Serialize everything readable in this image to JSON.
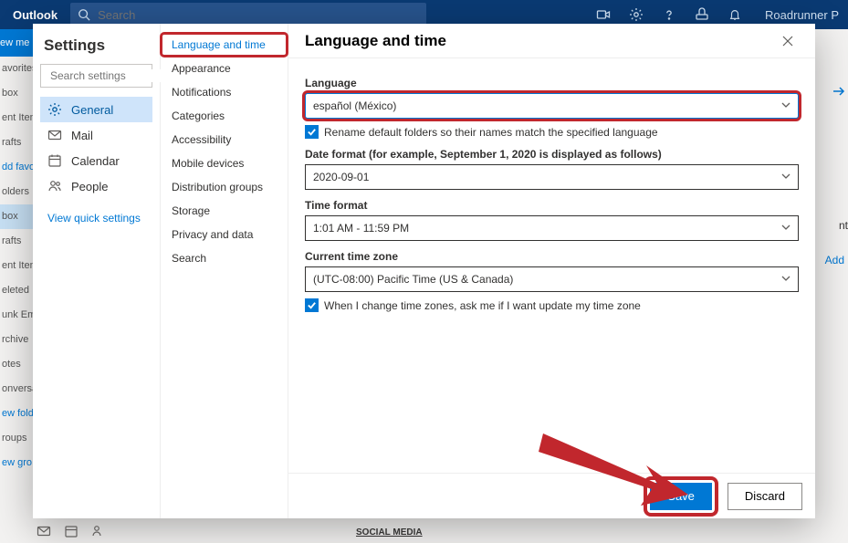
{
  "header": {
    "logo": "Outlook",
    "search_placeholder": "Search",
    "user": "Roadrunner P"
  },
  "leftnav": {
    "new_message": "ew me",
    "items": [
      "avorites",
      "box",
      "ent Item",
      "rafts",
      "dd favo",
      "olders",
      "box",
      "rafts",
      "ent Item",
      "eleted I",
      "unk Ema",
      "rchive",
      "otes",
      "onversa",
      "ew fold",
      "roups",
      "ew gro"
    ],
    "selected_index": 6
  },
  "peek": {
    "right_arrow": "→",
    "nt": "nt",
    "add": "Add"
  },
  "settings": {
    "title": "Settings",
    "search_placeholder": "Search settings",
    "categories": [
      {
        "icon": "gear",
        "label": "General"
      },
      {
        "icon": "mail",
        "label": "Mail"
      },
      {
        "icon": "calendar",
        "label": "Calendar"
      },
      {
        "icon": "people",
        "label": "People"
      }
    ],
    "selected_category": 0,
    "quick": "View quick settings",
    "subitems": [
      "Language and time",
      "Appearance",
      "Notifications",
      "Categories",
      "Accessibility",
      "Mobile devices",
      "Distribution groups",
      "Storage",
      "Privacy and data",
      "Search"
    ],
    "selected_subitem": 0
  },
  "pane": {
    "title": "Language and time",
    "language_label": "Language",
    "language_value": "español (México)",
    "rename_checkbox": "Rename default folders so their names match the specified language",
    "date_label": "Date format (for example, September 1, 2020 is displayed as follows)",
    "date_value": "2020-09-01",
    "time_label": "Time format",
    "time_value": "1:01 AM - 11:59 PM",
    "tz_label": "Current time zone",
    "tz_value": "(UTC-08:00) Pacific Time (US & Canada)",
    "tz_checkbox": "When I change time zones, ask me if I want update my time zone",
    "save": "Save",
    "discard": "Discard"
  },
  "bottom_label": "SOCIAL MEDIA"
}
